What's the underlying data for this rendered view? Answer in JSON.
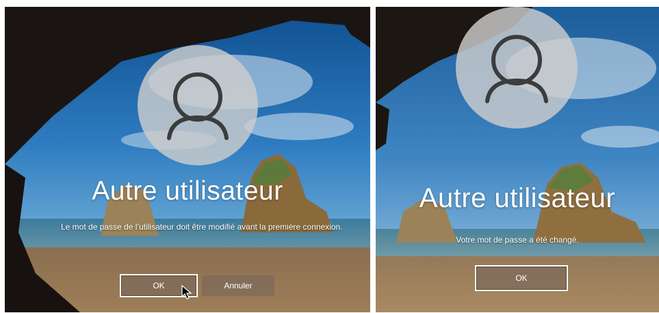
{
  "left_screen": {
    "user_name": "Autre utilisateur",
    "message": "Le mot de passe de l’utilisateur doit être modifié avant la première connexion.",
    "ok_label": "OK",
    "cancel_label": "Annuler"
  },
  "right_screen": {
    "user_name": "Autre utilisateur",
    "message": "Votre mot de passe a été changé.",
    "ok_label": "OK"
  },
  "colors": {
    "button_bg": "#7d695a",
    "text": "#ffffff",
    "avatar_bg": "#cdcdcd",
    "avatar_glyph": "#3c3c3c"
  },
  "icons": [
    "user-avatar-icon",
    "mouse-pointer-icon"
  ]
}
